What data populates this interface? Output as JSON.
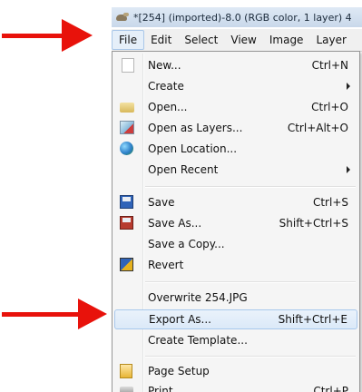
{
  "window": {
    "title": "*[254] (imported)-8.0 (RGB color, 1 layer) 4"
  },
  "menubar": {
    "items": [
      "File",
      "Edit",
      "Select",
      "View",
      "Image",
      "Layer"
    ],
    "active_index": 0
  },
  "file_menu": {
    "items": [
      {
        "label": "New...",
        "shortcut": "Ctrl+N",
        "icon": "new-document-icon"
      },
      {
        "label": "Create",
        "shortcut": "",
        "icon": "",
        "submenu": true
      },
      {
        "label": "Open...",
        "shortcut": "Ctrl+O",
        "icon": "folder-icon"
      },
      {
        "label": "Open as Layers...",
        "shortcut": "Ctrl+Alt+O",
        "icon": "layers-icon"
      },
      {
        "label": "Open Location...",
        "shortcut": "",
        "icon": "globe-icon"
      },
      {
        "label": "Open Recent",
        "shortcut": "",
        "icon": "",
        "submenu": true
      },
      {
        "label": "Save",
        "shortcut": "Ctrl+S",
        "icon": "save-icon"
      },
      {
        "label": "Save As...",
        "shortcut": "Shift+Ctrl+S",
        "icon": "save-as-icon"
      },
      {
        "label": "Save a Copy...",
        "shortcut": "",
        "icon": ""
      },
      {
        "label": "Revert",
        "shortcut": "",
        "icon": "revert-icon"
      },
      {
        "label": "Overwrite 254.JPG",
        "shortcut": "",
        "icon": ""
      },
      {
        "label": "Export As...",
        "shortcut": "Shift+Ctrl+E",
        "icon": "",
        "highlighted": true
      },
      {
        "label": "Create Template...",
        "shortcut": "",
        "icon": ""
      },
      {
        "label": "Page Setup",
        "shortcut": "",
        "icon": "page-setup-icon"
      },
      {
        "label": "Print...",
        "shortcut": "Ctrl+P",
        "icon": "print-icon"
      }
    ]
  },
  "annotations": {
    "arrow_color": "#e8120b",
    "arrows": [
      "pointing-to-file-menu",
      "pointing-to-export-as"
    ]
  },
  "colors": {
    "highlight_bg": "#dbe9f8",
    "highlight_border": "#a8c8ec",
    "menu_bg": "#f5f5f5"
  }
}
